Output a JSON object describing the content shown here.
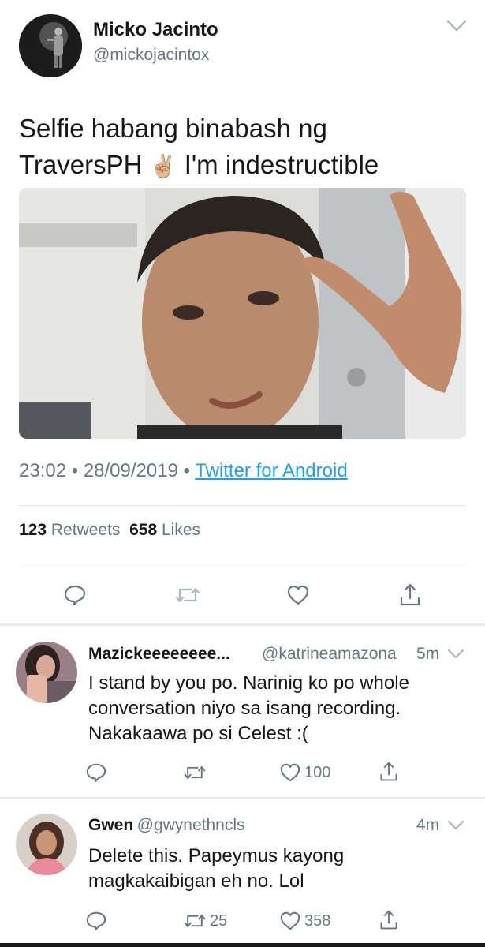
{
  "tweet": {
    "author_name": "Micko Jacinto",
    "author_handle": "@mickojacintox",
    "text_line1": "Selfie habang binabash ng",
    "text_line2_a": "TraversPH",
    "emoji": "✌🏼",
    "text_line2_b": "I'm indestructible",
    "time": "23:02",
    "date": "28/09/2019",
    "source": "Twitter for Android",
    "retweet_count": "123",
    "retweet_label": "Retweets",
    "like_count": "658",
    "like_label": "Likes"
  },
  "replies": [
    {
      "name": "Mazickeeeeeeee...",
      "handle": "@katrineamazona",
      "time": "5m",
      "text": "I stand by you po. Narinig ko po whole conversation niyo sa isang recording. Nakakaawa po si Celest :(",
      "retweets": "",
      "likes": "100"
    },
    {
      "name": "Gwen",
      "handle": "@gwynethncls",
      "time": "4m",
      "text": "Delete this. Papeymus kayong magkakaibigan eh no. Lol",
      "retweets": "25",
      "likes": "358"
    }
  ],
  "icons": {
    "reply": "reply-icon",
    "retweet": "retweet-icon",
    "like": "heart-icon",
    "share": "share-icon",
    "more": "chevron-down-icon"
  },
  "colors": {
    "link": "#1da1f2",
    "secondary_text": "#657786",
    "primary_text": "#14171a"
  }
}
